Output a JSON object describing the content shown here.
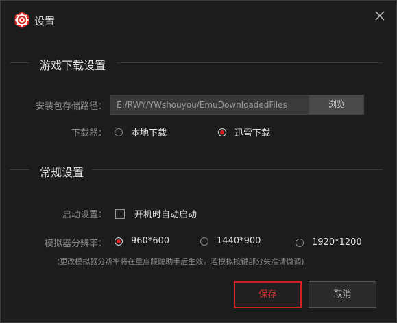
{
  "window": {
    "title": "设置"
  },
  "download_section": {
    "title": "游戏下载设置",
    "path_label": "安装包存储路径：",
    "path_value": "E:/RWY/YWshouyou/EmuDownloadedFiles",
    "browse_label": "浏览",
    "downloader_label": "下载器：",
    "downloader_options": [
      {
        "label": "本地下载",
        "selected": false
      },
      {
        "label": "迅雷下载",
        "selected": true
      }
    ]
  },
  "general_section": {
    "title": "常规设置",
    "startup_label": "启动设置：",
    "autostart_label": "开机时自动启动",
    "autostart_checked": false,
    "resolution_label": "模拟器分辨率：",
    "resolution_options": [
      {
        "label": "960*600",
        "selected": true
      },
      {
        "label": "1440*900",
        "selected": false
      },
      {
        "label": "1920*1200",
        "selected": false
      }
    ],
    "note": "(更改模拟器分辨率将在重启蹊蹺助手后生效，若模拟按键部分失准请微调)"
  },
  "buttons": {
    "save": "保存",
    "cancel": "取消"
  },
  "colors": {
    "accent": "#e02020",
    "background": "#1c1c1c"
  },
  "icons": {
    "logo": "gear-logo-icon",
    "close": "close-icon"
  }
}
